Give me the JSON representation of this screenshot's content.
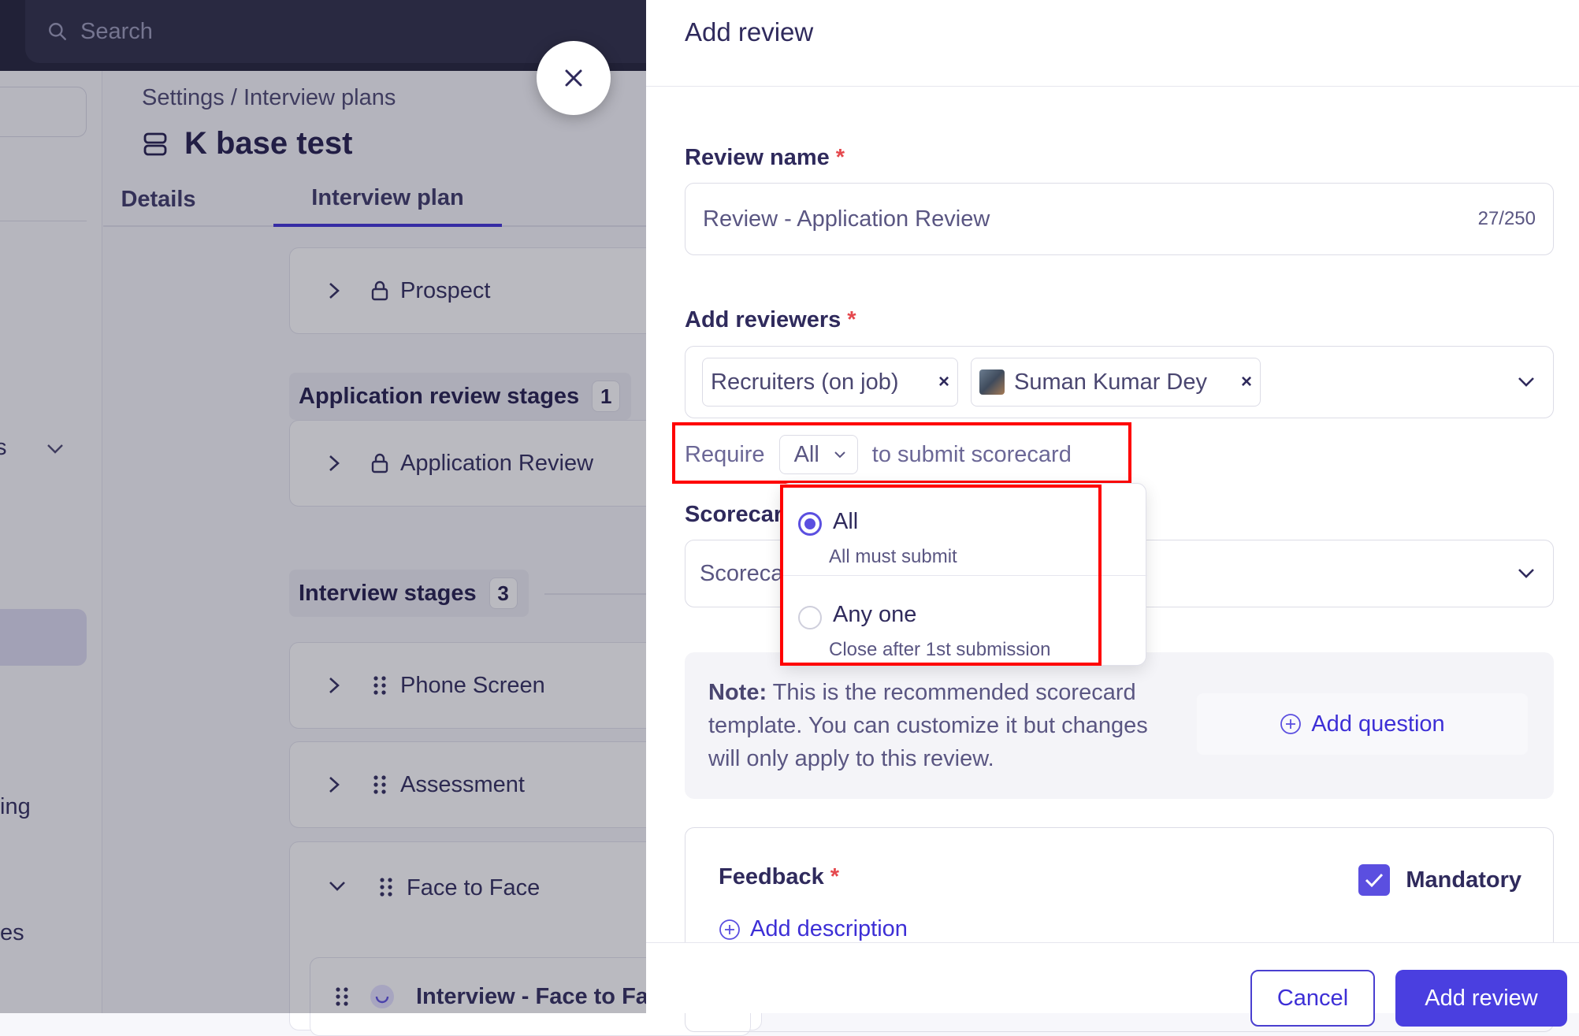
{
  "topbar": {
    "search_placeholder": "Search"
  },
  "left_nav": {
    "frag_1": "s",
    "frag_2": "ing",
    "frag_3": "es"
  },
  "page": {
    "breadcrumb": "Settings / Interview plans",
    "title": "K base test",
    "tabs": [
      "Details",
      "Interview plan"
    ]
  },
  "stages": {
    "prospect": "Prospect",
    "app_section": {
      "label": "Application review stages",
      "count": "1"
    },
    "app_review": "Application Review",
    "interview_section": {
      "label": "Interview stages",
      "count": "3"
    },
    "phone_screen": "Phone Screen",
    "assessment": "Assessment",
    "face_to_face": "Face to Face",
    "sub_interview": "Interview - Face to Fac"
  },
  "drawer": {
    "title": "Add review",
    "review_name": {
      "label": "Review name",
      "required": "*",
      "value": "Review - Application Review",
      "count": "27/250"
    },
    "reviewers": {
      "label": "Add reviewers",
      "required": "*",
      "chips": [
        "Recruiters (on job)",
        "Suman Kumar Dey"
      ],
      "remove": "×"
    },
    "require": {
      "prefix": "Require",
      "selected": "All",
      "suffix": "to submit scorecard"
    },
    "scorecard": {
      "label": "Scorecar",
      "placeholder": "Scoreca"
    },
    "note": {
      "bold": "Note:",
      "text": " This is the recommended scorecard template. You can customize it but changes will only apply to this review.",
      "add_question": "Add question"
    },
    "feedback": {
      "label": "Feedback",
      "required": "*",
      "mandatory": "Mandatory",
      "add_description": "Add description"
    },
    "footer": {
      "cancel": "Cancel",
      "submit": "Add review"
    }
  },
  "dropdown": {
    "options": [
      {
        "label": "All",
        "sub": "All must submit",
        "selected": true
      },
      {
        "label": "Any one",
        "sub": "Close after 1st submission",
        "selected": false
      }
    ]
  },
  "colors": {
    "accent": "#4a3fe0",
    "highlight": "#ff0000",
    "required": "#e5484d"
  }
}
